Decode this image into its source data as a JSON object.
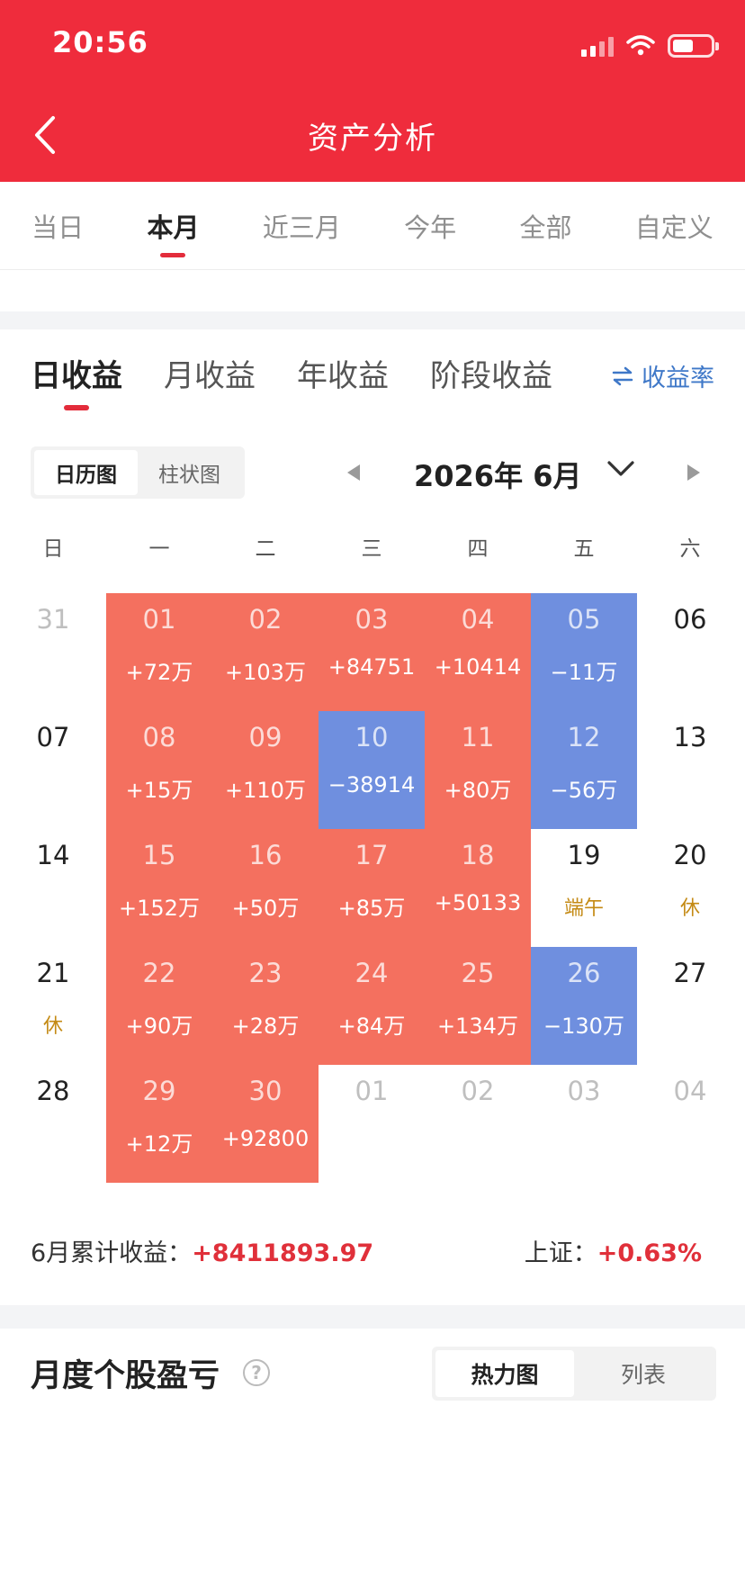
{
  "status": {
    "time": "20:56"
  },
  "header": {
    "title": "资产分析"
  },
  "period_tabs": [
    {
      "label": "当日",
      "active": false
    },
    {
      "label": "本月",
      "active": true
    },
    {
      "label": "近三月",
      "active": false
    },
    {
      "label": "今年",
      "active": false
    },
    {
      "label": "全部",
      "active": false
    },
    {
      "label": "自定义",
      "active": false
    }
  ],
  "income_tabs": [
    {
      "label": "日收益",
      "active": true
    },
    {
      "label": "月收益",
      "active": false
    },
    {
      "label": "年收益",
      "active": false
    },
    {
      "label": "阶段收益",
      "active": false
    }
  ],
  "rate_toggle": {
    "label": "收益率"
  },
  "view_toggle": {
    "calendar": "日历图",
    "bar": "柱状图",
    "active": "calendar"
  },
  "month_nav": {
    "label": "2026年 6月"
  },
  "weekdays": [
    "日",
    "一",
    "二",
    "三",
    "四",
    "五",
    "六"
  ],
  "calendar_rows": [
    [
      {
        "day": "31",
        "type": "other"
      },
      {
        "day": "01",
        "type": "up",
        "value": "+72万"
      },
      {
        "day": "02",
        "type": "up",
        "value": "+103万"
      },
      {
        "day": "03",
        "type": "up",
        "value": "+84751"
      },
      {
        "day": "04",
        "type": "up",
        "value": "+10414"
      },
      {
        "day": "05",
        "type": "down",
        "value": "−11万"
      },
      {
        "day": "06",
        "type": "plain"
      }
    ],
    [
      {
        "day": "07",
        "type": "plain"
      },
      {
        "day": "08",
        "type": "up",
        "value": "+15万"
      },
      {
        "day": "09",
        "type": "up",
        "value": "+110万"
      },
      {
        "day": "10",
        "type": "down",
        "value": "−38914"
      },
      {
        "day": "11",
        "type": "up",
        "value": "+80万"
      },
      {
        "day": "12",
        "type": "down",
        "value": "−56万"
      },
      {
        "day": "13",
        "type": "plain"
      }
    ],
    [
      {
        "day": "14",
        "type": "plain"
      },
      {
        "day": "15",
        "type": "up",
        "value": "+152万"
      },
      {
        "day": "16",
        "type": "up",
        "value": "+50万"
      },
      {
        "day": "17",
        "type": "up",
        "value": "+85万"
      },
      {
        "day": "18",
        "type": "up",
        "value": "+50133"
      },
      {
        "day": "19",
        "type": "plain",
        "tag": "端午"
      },
      {
        "day": "20",
        "type": "plain",
        "tag": "休"
      }
    ],
    [
      {
        "day": "21",
        "type": "plain",
        "tag": "休"
      },
      {
        "day": "22",
        "type": "up",
        "value": "+90万"
      },
      {
        "day": "23",
        "type": "up",
        "value": "+28万"
      },
      {
        "day": "24",
        "type": "up",
        "value": "+84万"
      },
      {
        "day": "25",
        "type": "up",
        "value": "+134万"
      },
      {
        "day": "26",
        "type": "down",
        "value": "−130万"
      },
      {
        "day": "27",
        "type": "plain"
      }
    ],
    [
      {
        "day": "28",
        "type": "plain"
      },
      {
        "day": "29",
        "type": "up",
        "value": "+12万"
      },
      {
        "day": "30",
        "type": "up",
        "value": "+92800"
      },
      {
        "day": "01",
        "type": "other"
      },
      {
        "day": "02",
        "type": "other"
      },
      {
        "day": "03",
        "type": "other"
      },
      {
        "day": "04",
        "type": "other"
      }
    ]
  ],
  "summary": {
    "month_label": "6月累计收益：",
    "month_value": "+8411893.97",
    "index_label": "上证：",
    "index_value": "+0.63%"
  },
  "stock_section": {
    "title": "月度个股盈亏",
    "help": "?",
    "heatmap": "热力图",
    "list": "列表",
    "active": "heatmap"
  },
  "colors": {
    "brand_red": "#ef2c3c",
    "gain": "#f4705f",
    "loss": "#6f8fdf",
    "holiday_tag": "#c48a14",
    "link_blue": "#3f78c8"
  },
  "icons": {
    "back": "chevron-left-icon",
    "prev_month": "triangle-left-icon",
    "next_month": "triangle-right-icon",
    "dropdown": "chevron-down-icon",
    "swap": "swap-arrows-icon",
    "help": "question-circle-icon"
  }
}
